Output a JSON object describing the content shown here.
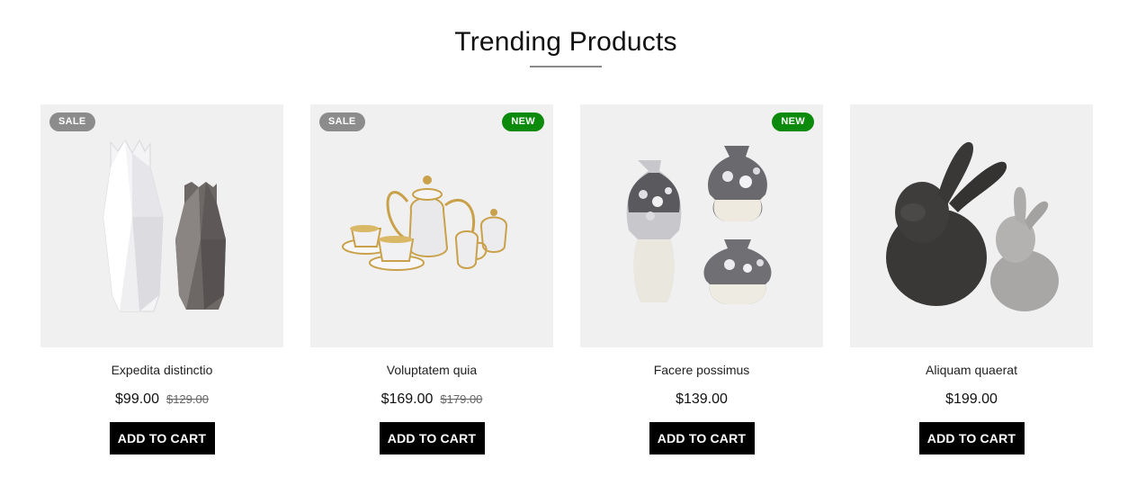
{
  "section": {
    "title": "Trending Products"
  },
  "products": [
    {
      "name": "Expedita distinctio",
      "price": "$99.00",
      "old_price": "$129.00",
      "badge_left": "SALE",
      "badge_right": "",
      "image": "white and grey geometric vases",
      "button_label": "ADD TO CART"
    },
    {
      "name": "Voluptatem quia",
      "price": "$169.00",
      "old_price": "$179.00",
      "badge_left": "SALE",
      "badge_right": "NEW",
      "image": "white and gold tea set",
      "button_label": "ADD TO CART"
    },
    {
      "name": "Facere possimus",
      "price": "$139.00",
      "old_price": "",
      "badge_left": "",
      "badge_right": "NEW",
      "image": "silver mosaic vases",
      "button_label": "ADD TO CART"
    },
    {
      "name": "Aliquam quaerat",
      "price": "$199.00",
      "old_price": "",
      "badge_left": "",
      "badge_right": "",
      "image": "black and grey ceramic rabbits",
      "button_label": "ADD TO CART"
    }
  ],
  "colors": {
    "badge_sale": "#8c8c8c",
    "badge_new": "#0b8a0b",
    "button_bg": "#000000",
    "image_bg": "#f0f0f0"
  }
}
